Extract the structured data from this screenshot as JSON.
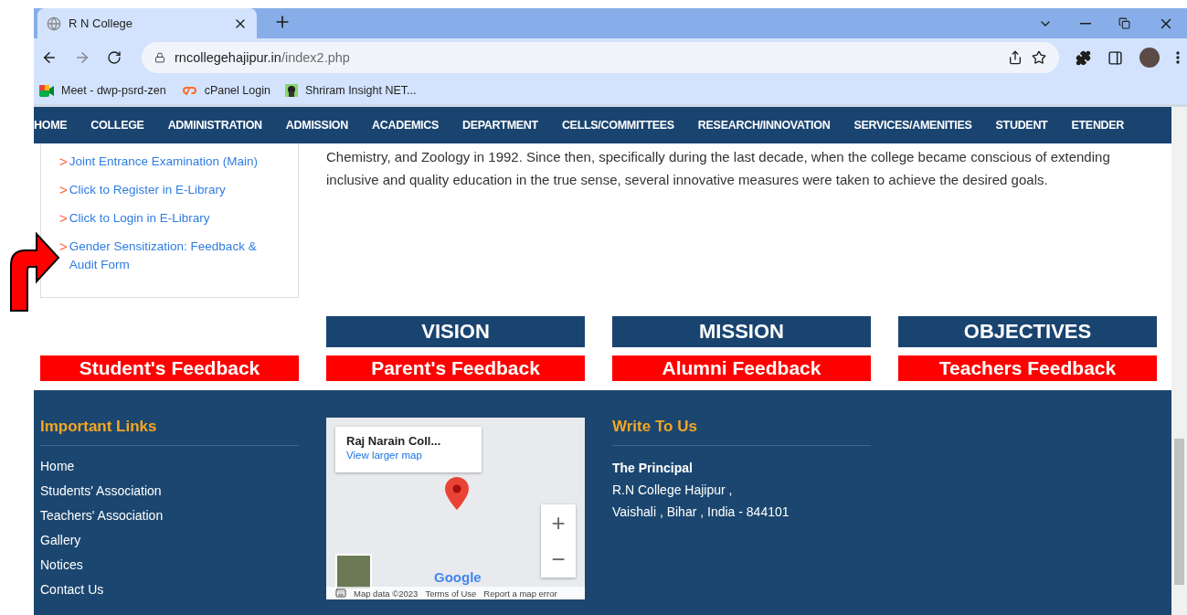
{
  "browser": {
    "tab_title": "R N College",
    "url_domain": "rncollegehajipur.in",
    "url_path": "/index2.php",
    "bookmarks": [
      {
        "label": "Meet - dwp-psrd-zen",
        "kind": "meet"
      },
      {
        "label": "cPanel Login",
        "kind": "cpanel"
      },
      {
        "label": "Shriram Insight NET...",
        "kind": "shriram"
      }
    ]
  },
  "nav": [
    "HOME",
    "COLLEGE",
    "ADMINISTRATION",
    "ADMISSION",
    "ACADEMICS",
    "DEPARTMENT",
    "CELLS/COMMITTEES",
    "RESEARCH/INNOVATION",
    "SERVICES/AMENITIES",
    "STUDENT",
    "ETENDER"
  ],
  "sidebar_links": [
    {
      "marker": ">",
      "label": "Joint Entrance Examination (Main)"
    },
    {
      "marker": ">",
      "label": "Click to Register in E-Library"
    },
    {
      "marker": ">",
      "label": "Click to Login in E-Library"
    },
    {
      "marker": ">",
      "label": "Gender Sensitization: Feedback & Audit Form"
    }
  ],
  "intro_lines": [
    "Chemistry, and Zoology in 1992. Since then, specifically during the last decade, when the college became conscious of extending",
    "inclusive and quality education in the true sense, several innovative measures were taken to achieve the desired goals."
  ],
  "headings": [
    "VISION",
    "MISSION",
    "OBJECTIVES"
  ],
  "feedback_buttons": [
    "Student's Feedback",
    "Parent's Feedback",
    "Alumni Feedback",
    "Teachers Feedback"
  ],
  "footer": {
    "links_title": "Important Links",
    "links": [
      "Home",
      "Students' Association",
      "Teachers' Association",
      "Gallery",
      "Notices",
      "Contact Us"
    ],
    "map": {
      "place": "Raj Narain Coll...",
      "larger_link": "View larger map",
      "zoom_in": "+",
      "zoom_out": "−",
      "logo": "Google",
      "attribution": [
        "Map data ©2023",
        "Terms of Use",
        "Report a map error"
      ]
    },
    "write_title": "Write To Us",
    "address_name": "The Principal",
    "address_lines": [
      "R.N College Hajipur ,",
      "Vaishali , Bihar , India - 844101"
    ]
  }
}
